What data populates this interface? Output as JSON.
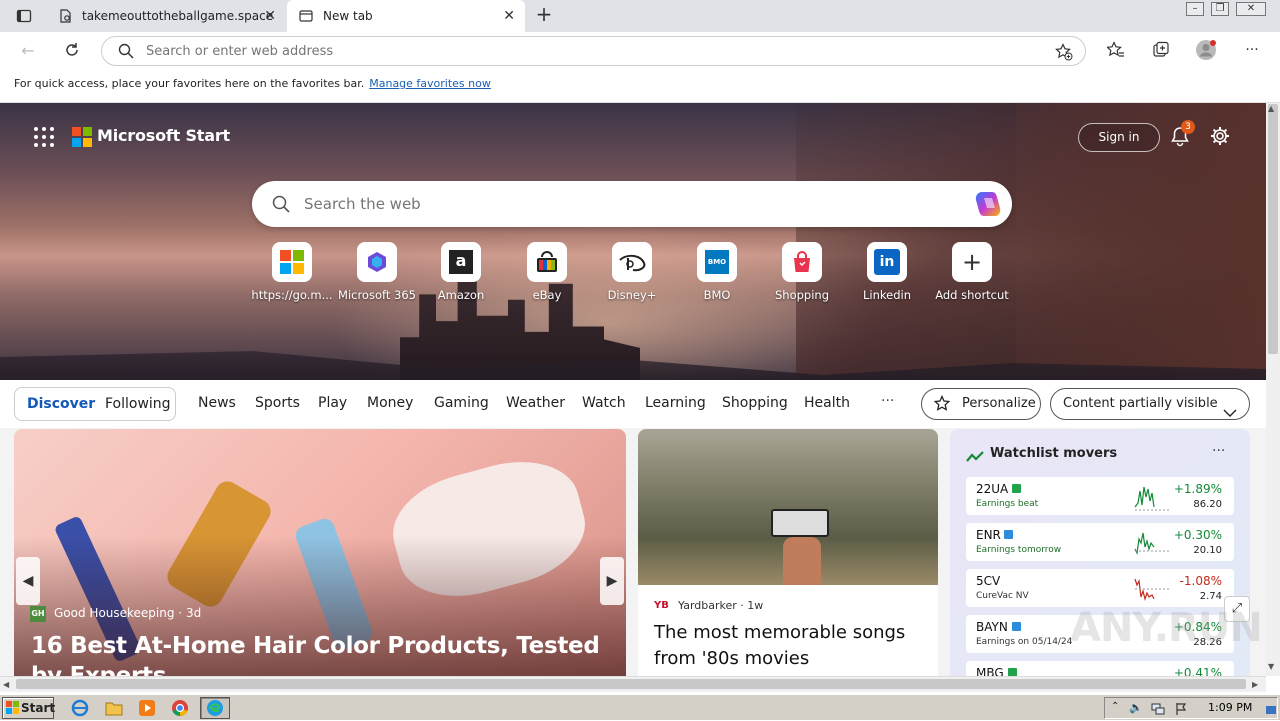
{
  "browser": {
    "tabs": [
      {
        "title": "takemeouttotheballgame.space",
        "active": false
      },
      {
        "title": "New tab",
        "active": true
      }
    ],
    "address_placeholder": "Search or enter web address",
    "favbar_text": "For quick access, place your favorites here on the favorites bar.",
    "favbar_link": "Manage favorites now"
  },
  "page": {
    "brand": "Microsoft Start",
    "sign_in": "Sign in",
    "notification_count": "3",
    "search_placeholder": "Search the web",
    "shortcuts": [
      {
        "label": "https://go.m...",
        "icon": "windows-logo-icon"
      },
      {
        "label": "Microsoft 365",
        "icon": "microsoft-365-icon"
      },
      {
        "label": "Amazon",
        "icon": "amazon-icon"
      },
      {
        "label": "eBay",
        "icon": "ebay-icon"
      },
      {
        "label": "Disney+",
        "icon": "disney-plus-icon"
      },
      {
        "label": "BMO",
        "icon": "bmo-icon"
      },
      {
        "label": "Shopping",
        "icon": "shopping-bag-icon"
      },
      {
        "label": "Linkedin",
        "icon": "linkedin-icon"
      },
      {
        "label": "Add shortcut",
        "icon": "plus-icon"
      }
    ],
    "feed_tabs": {
      "discover": "Discover",
      "following": "Following"
    },
    "categories": [
      "News",
      "Sports",
      "Play",
      "Money",
      "Gaming",
      "Weather",
      "Watch",
      "Learning",
      "Shopping",
      "Health"
    ],
    "more": "···",
    "personalize": "Personalize",
    "content_visibility": "Content partially visible"
  },
  "cards": {
    "hero": {
      "source": "Good Housekeeping",
      "age": "3d",
      "title": "16 Best At-Home Hair Color Products, Tested by Experts"
    },
    "second": {
      "source": "Yardbarker",
      "age": "1w",
      "title": "The most memorable songs from '80s movies"
    },
    "watchlist": {
      "title": "Watchlist movers",
      "more": "···",
      "stocks": [
        {
          "symbol": "22UA",
          "sub": "Earnings beat",
          "change": "+1.89%",
          "price": "86.20",
          "direction": "up"
        },
        {
          "symbol": "ENR",
          "sub": "Earnings tomorrow",
          "change": "+0.30%",
          "price": "20.10",
          "direction": "up"
        },
        {
          "symbol": "5CV",
          "sub": "CureVac NV",
          "change": "-1.08%",
          "price": "2.74",
          "direction": "down"
        },
        {
          "symbol": "BAYN",
          "sub": "Earnings on 05/14/24",
          "change": "+0.84%",
          "price": "28.26",
          "direction": "up"
        },
        {
          "symbol": "MBG",
          "sub": "",
          "change": "+0.41%",
          "price": "",
          "direction": "up"
        }
      ]
    }
  },
  "taskbar": {
    "start": "Start",
    "clock": "1:09 PM"
  },
  "watermark": "ANY.RUN",
  "colors": {
    "accent": "#1158b7",
    "up": "#138a36",
    "down": "#c42b1c",
    "badge": "#e05a1b"
  }
}
